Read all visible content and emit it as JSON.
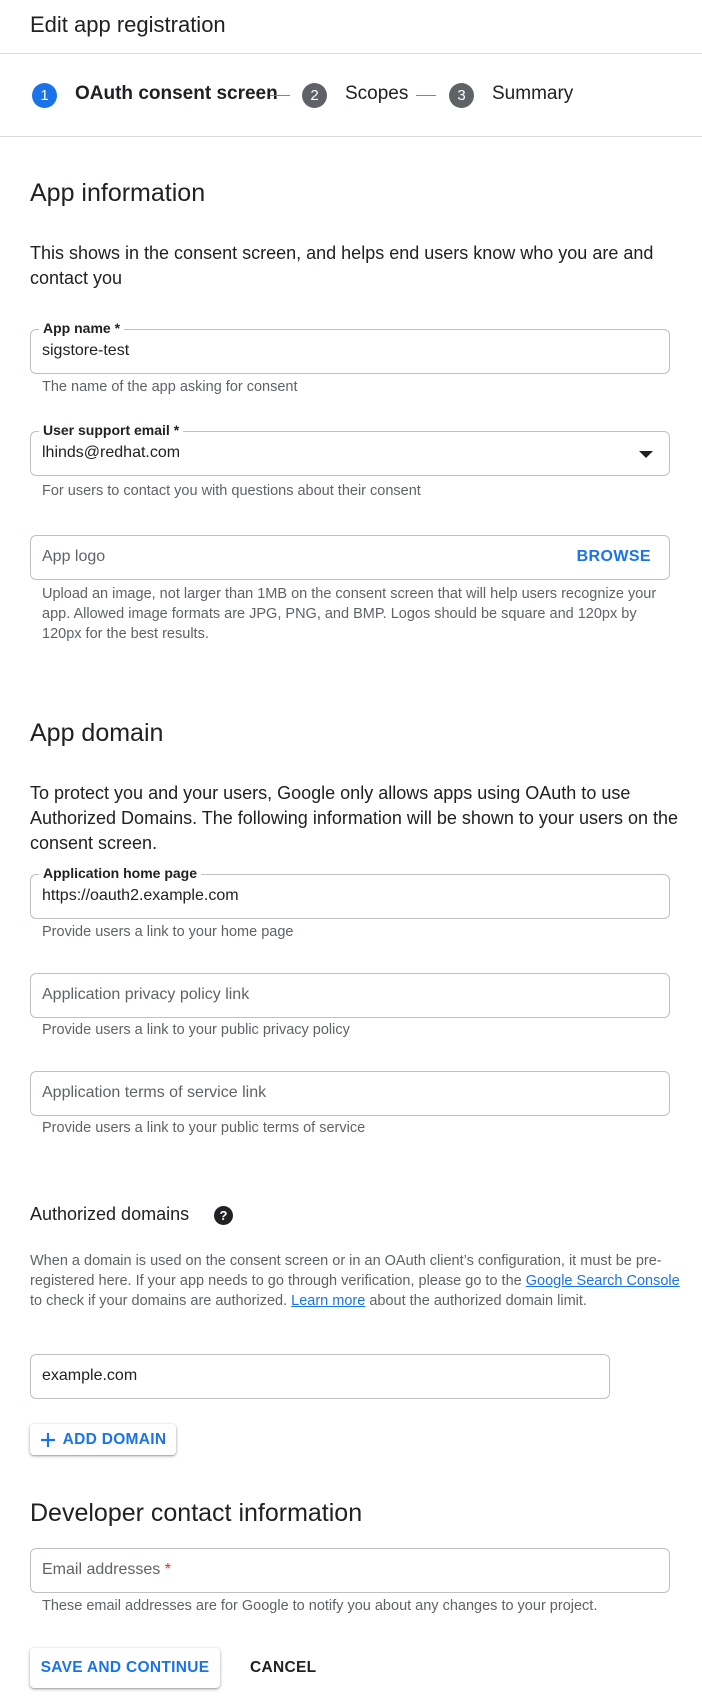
{
  "header": {
    "title": "Edit app registration"
  },
  "stepper": {
    "steps": [
      {
        "number": "1",
        "label": "OAuth consent screen",
        "active": true
      },
      {
        "number": "2",
        "label": "Scopes",
        "active": false
      },
      {
        "number": "3",
        "label": "Summary",
        "active": false
      }
    ]
  },
  "app_info": {
    "heading": "App information",
    "description": "This shows in the consent screen, and helps end users know who you are and contact you",
    "app_name": {
      "label": "App name *",
      "value": "sigstore-test",
      "hint": "The name of the app asking for consent"
    },
    "support_email": {
      "label": "User support email *",
      "value": "lhinds@redhat.com",
      "hint": "For users to contact you with questions about their consent"
    },
    "logo": {
      "placeholder": "App logo",
      "browse": "BROWSE",
      "hint": "Upload an image, not larger than 1MB on the consent screen that will help users recognize your app. Allowed image formats are JPG, PNG, and BMP. Logos should be square and 120px by 120px for the best results."
    }
  },
  "app_domain": {
    "heading": "App domain",
    "description": "To protect you and your users, Google only allows apps using OAuth to use Authorized Domains. The following information will be shown to your users on the consent screen.",
    "home_page": {
      "label": "Application home page",
      "value": "https://oauth2.example.com",
      "hint": "Provide users a link to your home page"
    },
    "privacy": {
      "placeholder": "Application privacy policy link",
      "hint": "Provide users a link to your public privacy policy"
    },
    "terms": {
      "placeholder": "Application terms of service link",
      "hint": "Provide users a link to your public terms of service"
    }
  },
  "authorized_domains": {
    "heading": "Authorized domains",
    "help_icon": "help-circle-icon",
    "text_before": "When a domain is used on the consent screen or in an OAuth client’s configuration, it must be pre-registered here. If your app needs to go through verification, please go to the ",
    "link1": "Google Search Console",
    "text_middle": " to check if your domains are authorized. ",
    "link2": "Learn more",
    "text_after": " about the authorized domain limit.",
    "domain_value": "example.com",
    "add_button": "ADD DOMAIN"
  },
  "developer_contact": {
    "heading": "Developer contact information",
    "email_placeholder": "Email addresses",
    "required_mark": "*",
    "hint": "These email addresses are for Google to notify you about any changes to your project."
  },
  "actions": {
    "save": "SAVE AND CONTINUE",
    "cancel": "CANCEL"
  },
  "colors": {
    "accent": "#1a73e8",
    "step_active": "#1a73e8",
    "step_inactive": "#5f6368",
    "required": "#d93025"
  }
}
